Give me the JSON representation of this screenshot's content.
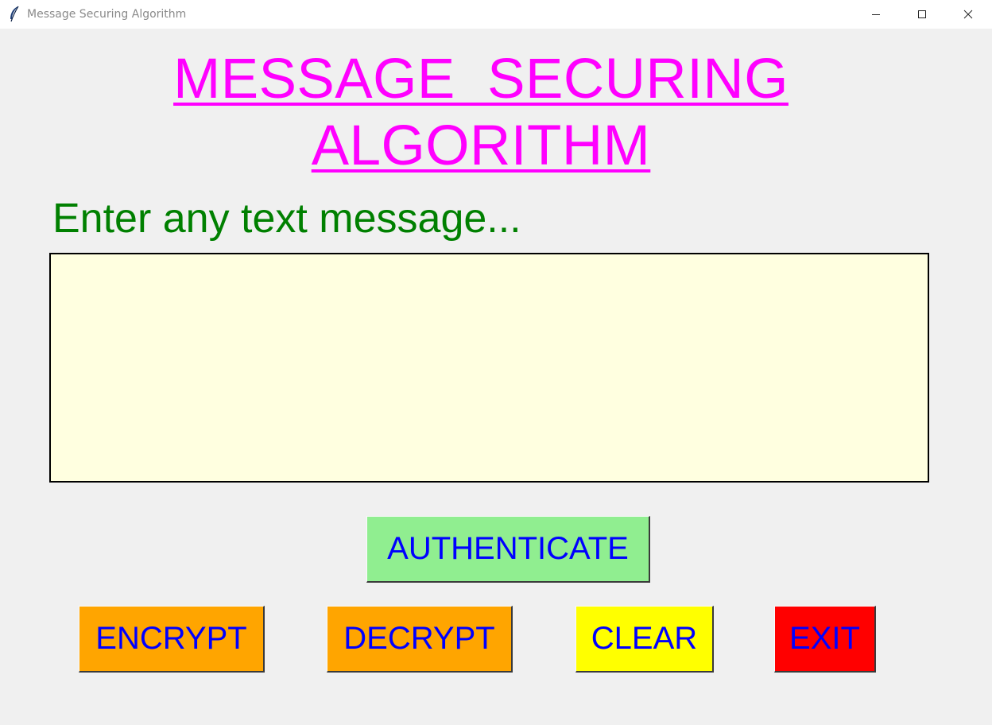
{
  "window": {
    "title": "Message Securing Algorithm",
    "icon": "feather-icon",
    "controls": [
      "minimize-icon",
      "maximize-icon",
      "close-icon"
    ]
  },
  "heading": {
    "line1": "MESSAGE  SECURING",
    "line2": "ALGORITHM"
  },
  "prompt": {
    "label": "Enter any text message..."
  },
  "message": {
    "value": ""
  },
  "buttons": {
    "authenticate": "AUTHENTICATE",
    "encrypt": "ENCRYPT",
    "decrypt": "DECRYPT",
    "clear": "CLEAR",
    "exit": "EXIT"
  },
  "colors": {
    "background": "#f0f0f0",
    "heading": "#ff00ff",
    "prompt": "#008000",
    "message_box": "#ffffe0",
    "button_text": "#0000ff",
    "authenticate": "#90ee90",
    "encrypt": "#ffa500",
    "decrypt": "#ffa500",
    "clear": "#ffff00",
    "exit": "#ff0000"
  }
}
